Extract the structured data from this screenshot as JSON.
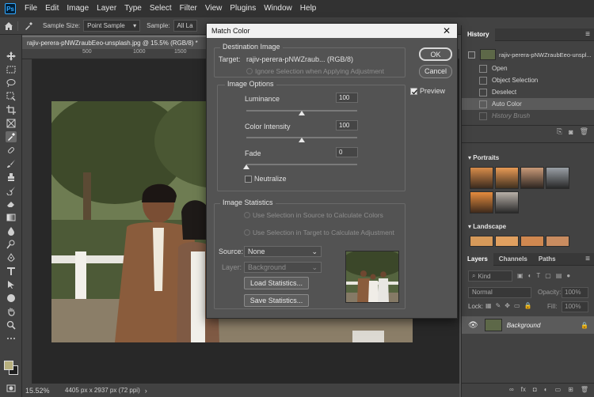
{
  "app": {
    "logo": "Ps"
  },
  "menu": [
    "File",
    "Edit",
    "Image",
    "Layer",
    "Type",
    "Select",
    "Filter",
    "View",
    "Plugins",
    "Window",
    "Help"
  ],
  "options": {
    "sample_size_label": "Sample Size:",
    "sample_size_value": "Point Sample",
    "sample_label": "Sample:",
    "sample_value": "All La"
  },
  "document": {
    "tab_title": "rajiv-perera-pNWZraubEeo-unsplash.jpg @ 15.5% (RGB/8) *",
    "ruler_marks": [
      "500",
      "1000",
      "1500"
    ],
    "zoom": "15.52%",
    "info": "4405 px x 2937 px (72 ppi)"
  },
  "dialog": {
    "title": "Match Color",
    "destination_group": "Destination Image",
    "target_label": "Target:",
    "target_value": "rajiv-perera-pNWZraub... (RGB/8)",
    "ignore_selection": "Ignore Selection when Applying Adjustment",
    "image_options_group": "Image Options",
    "luminance_label": "Luminance",
    "luminance_value": "100",
    "color_intensity_label": "Color Intensity",
    "color_intensity_value": "100",
    "fade_label": "Fade",
    "fade_value": "0",
    "neutralize_label": "Neutralize",
    "image_statistics_group": "Image Statistics",
    "use_sel_source": "Use Selection in Source to Calculate Colors",
    "use_sel_target": "Use Selection in Target to Calculate Adjustment",
    "source_label": "Source:",
    "source_value": "None",
    "layer_label": "Layer:",
    "layer_value": "Background",
    "load_stats": "Load Statistics...",
    "save_stats": "Save Statistics...",
    "ok": "OK",
    "cancel": "Cancel",
    "preview_label": "Preview",
    "luminance_level": 0.5,
    "color_intensity_level": 0.5,
    "fade_level": 0.0
  },
  "history": {
    "tab": "History",
    "snapshot_name": "rajiv-perera-pNWZraubEeo-unspl...",
    "items": [
      {
        "label": "Open"
      },
      {
        "label": "Object Selection"
      },
      {
        "label": "Deselect"
      },
      {
        "label": "Auto Color"
      },
      {
        "label": "History Brush"
      }
    ]
  },
  "presets": {
    "portraits": "Portraits",
    "landscape": "Landscape"
  },
  "layers": {
    "tabs": [
      "Layers",
      "Channels",
      "Paths"
    ],
    "kind_placeholder": "Kind",
    "blend_mode": "Normal",
    "opacity_label": "Opacity:",
    "opacity_value": "100%",
    "lock_label": "Lock:",
    "fill_label": "Fill:",
    "fill_value": "100%",
    "layer_name": "Background"
  },
  "colors": {
    "accent": "#31a8ff"
  }
}
